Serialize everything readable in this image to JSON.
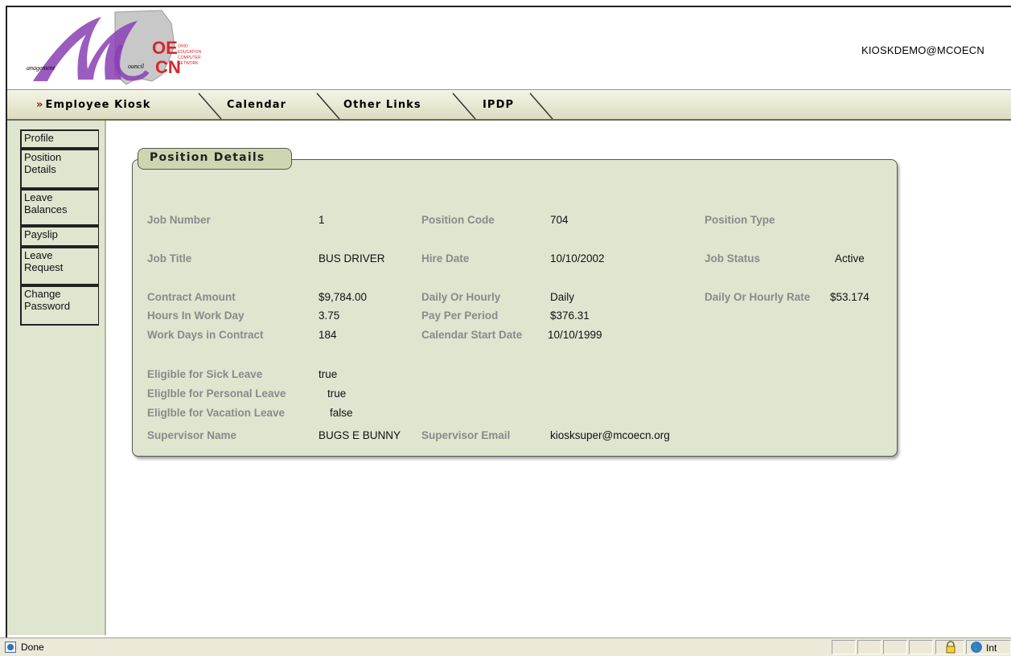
{
  "header": {
    "user": "KIOSKDEMO@MCOECN"
  },
  "logo": {
    "left_script": "anagement",
    "right_script": "ouncil",
    "oecn_lines": [
      "OHIO",
      "EDUCATION",
      "COMPUTER",
      "NETWORK"
    ]
  },
  "nav": {
    "prefix": "»",
    "tabs": [
      "Employee Kiosk",
      "Calendar",
      "Other Links",
      "IPDP"
    ]
  },
  "sidebar": {
    "items": [
      {
        "label_1": "Profile",
        "label_2": ""
      },
      {
        "label_1": "Position",
        "label_2": "Details"
      },
      {
        "label_1": "Leave",
        "label_2": "Balances"
      },
      {
        "label_1": "Payslip",
        "label_2": ""
      },
      {
        "label_1": "Leave",
        "label_2": "Request"
      },
      {
        "label_1": "Change",
        "label_2": "Password"
      }
    ]
  },
  "panel": {
    "title": "Position Details",
    "fields": {
      "job_number_label": "Job Number",
      "job_number": "1",
      "position_code_label": "Position Code",
      "position_code": "704",
      "position_type_label": "Position Type",
      "position_type": "",
      "job_title_label": "Job Title",
      "job_title": "BUS DRIVER",
      "hire_date_label": "Hire Date",
      "hire_date": "10/10/2002",
      "job_status_label": "Job Status",
      "job_status": "Active",
      "contract_amount_label": "Contract Amount",
      "contract_amount": "$9,784.00",
      "daily_hourly_label": "Daily Or Hourly",
      "daily_hourly": "Daily",
      "rate_label": "Daily Or Hourly Rate",
      "rate": "$53.174",
      "hours_label": "Hours In Work Day",
      "hours": "3.75",
      "pay_period_label": "Pay Per Period",
      "pay_period": "$376.31",
      "work_days_label": "Work Days in Contract",
      "work_days": "184",
      "cal_start_label": "Calendar Start Date",
      "cal_start": "10/10/1999",
      "sick_label": "Eligible for Sick Leave",
      "sick": "true",
      "personal_label": "Eliglble for Personal Leave",
      "personal": "true",
      "vacation_label": "Eliglble for Vacation Leave",
      "vacation": "false",
      "supervisor_label": "Supervisor Name",
      "supervisor": "BUGS E BUNNY",
      "sup_email_label": "Supervisor Email",
      "sup_email": "kiosksuper@mcoecn.org"
    }
  },
  "status": {
    "text": "Done",
    "zone": "Int"
  },
  "colors": {
    "panel_bg": "#dfe5cf",
    "label_gray": "#8a8a8a",
    "nav_prefix": "#8b1a1a",
    "logo_purple": "#8a3fb5",
    "logo_red": "#d7262b"
  }
}
